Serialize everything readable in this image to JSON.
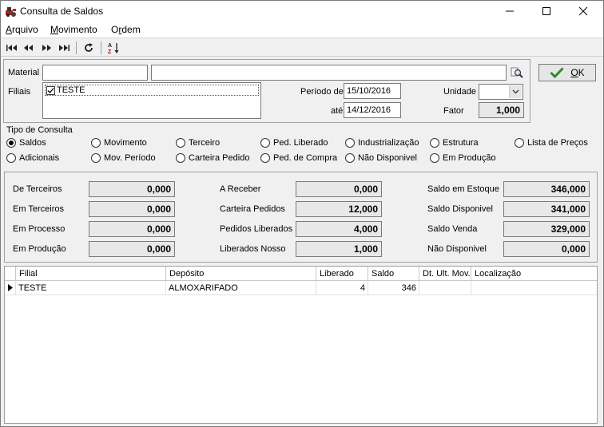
{
  "window": {
    "title": "Consulta de Saldos",
    "minimize": "—",
    "maximize": "☐",
    "close": "✕"
  },
  "menu": {
    "arquivo": {
      "u": "A",
      "rest": "rquivo"
    },
    "movimento": {
      "u": "M",
      "rest": "ovimento"
    },
    "ordem": {
      "pre": "O",
      "u": "r",
      "rest": "dem"
    }
  },
  "toolbar": {
    "first": "⏮",
    "prev": "◀◀",
    "next": "▶▶",
    "last": "⏭",
    "refresh": "↻",
    "sort": "A↓Z"
  },
  "filters": {
    "material_label": "Material",
    "material_code": "",
    "material_desc": "",
    "filiais_label": "Filiais",
    "filiais_items": [
      {
        "label": "TESTE",
        "checked": true
      }
    ],
    "periodo_label": "Período de",
    "periodo_de": "15/10/2016",
    "ate_label": "até",
    "periodo_ate": "14/12/2016",
    "unidade_label": "Unidade",
    "unidade_value": "",
    "fator_label": "Fator",
    "fator_value": "1,000"
  },
  "ok_button": {
    "u": "O",
    "rest": "K"
  },
  "tipo_consulta": {
    "label": "Tipo de Consulta",
    "selected": "Saldos",
    "options_row1": [
      "Saldos",
      "Movimento",
      "Terceiro",
      "Ped. Liberado",
      "Industrialização",
      "Estrutura",
      "Lista de Preços"
    ],
    "options_row2": [
      "Adicionais",
      "Mov. Período",
      "Carteira Pedido",
      "Ped. de Compra",
      "Não Disponivel",
      "Em Produção"
    ]
  },
  "totals": {
    "col1": [
      {
        "label": "De Terceiros",
        "value": "0,000"
      },
      {
        "label": "Em Terceiros",
        "value": "0,000"
      },
      {
        "label": "Em Processo",
        "value": "0,000"
      },
      {
        "label": "Em Produção",
        "value": "0,000"
      }
    ],
    "col2": [
      {
        "label": "A Receber",
        "value": "0,000"
      },
      {
        "label": "Carteira Pedidos",
        "value": "12,000"
      },
      {
        "label": "Pedidos Liberados",
        "value": "4,000"
      },
      {
        "label": "Liberados Nosso",
        "value": "1,000"
      }
    ],
    "col3": [
      {
        "label": "Saldo em Estoque",
        "value": "346,000"
      },
      {
        "label": "Saldo Disponivel",
        "value": "341,000"
      },
      {
        "label": "Saldo Venda",
        "value": "329,000"
      },
      {
        "label": "Não Disponivel",
        "value": "0,000"
      }
    ]
  },
  "grid": {
    "columns": [
      "Filial",
      "Depósito",
      "Liberado",
      "Saldo",
      "Dt. Ult. Mov.",
      "Localização"
    ],
    "rows": [
      {
        "filial": "TESTE",
        "deposito": "ALMOXARIFADO",
        "liberado": "4",
        "saldo": "346",
        "dt_ult_mov": "",
        "localizacao": ""
      }
    ]
  }
}
